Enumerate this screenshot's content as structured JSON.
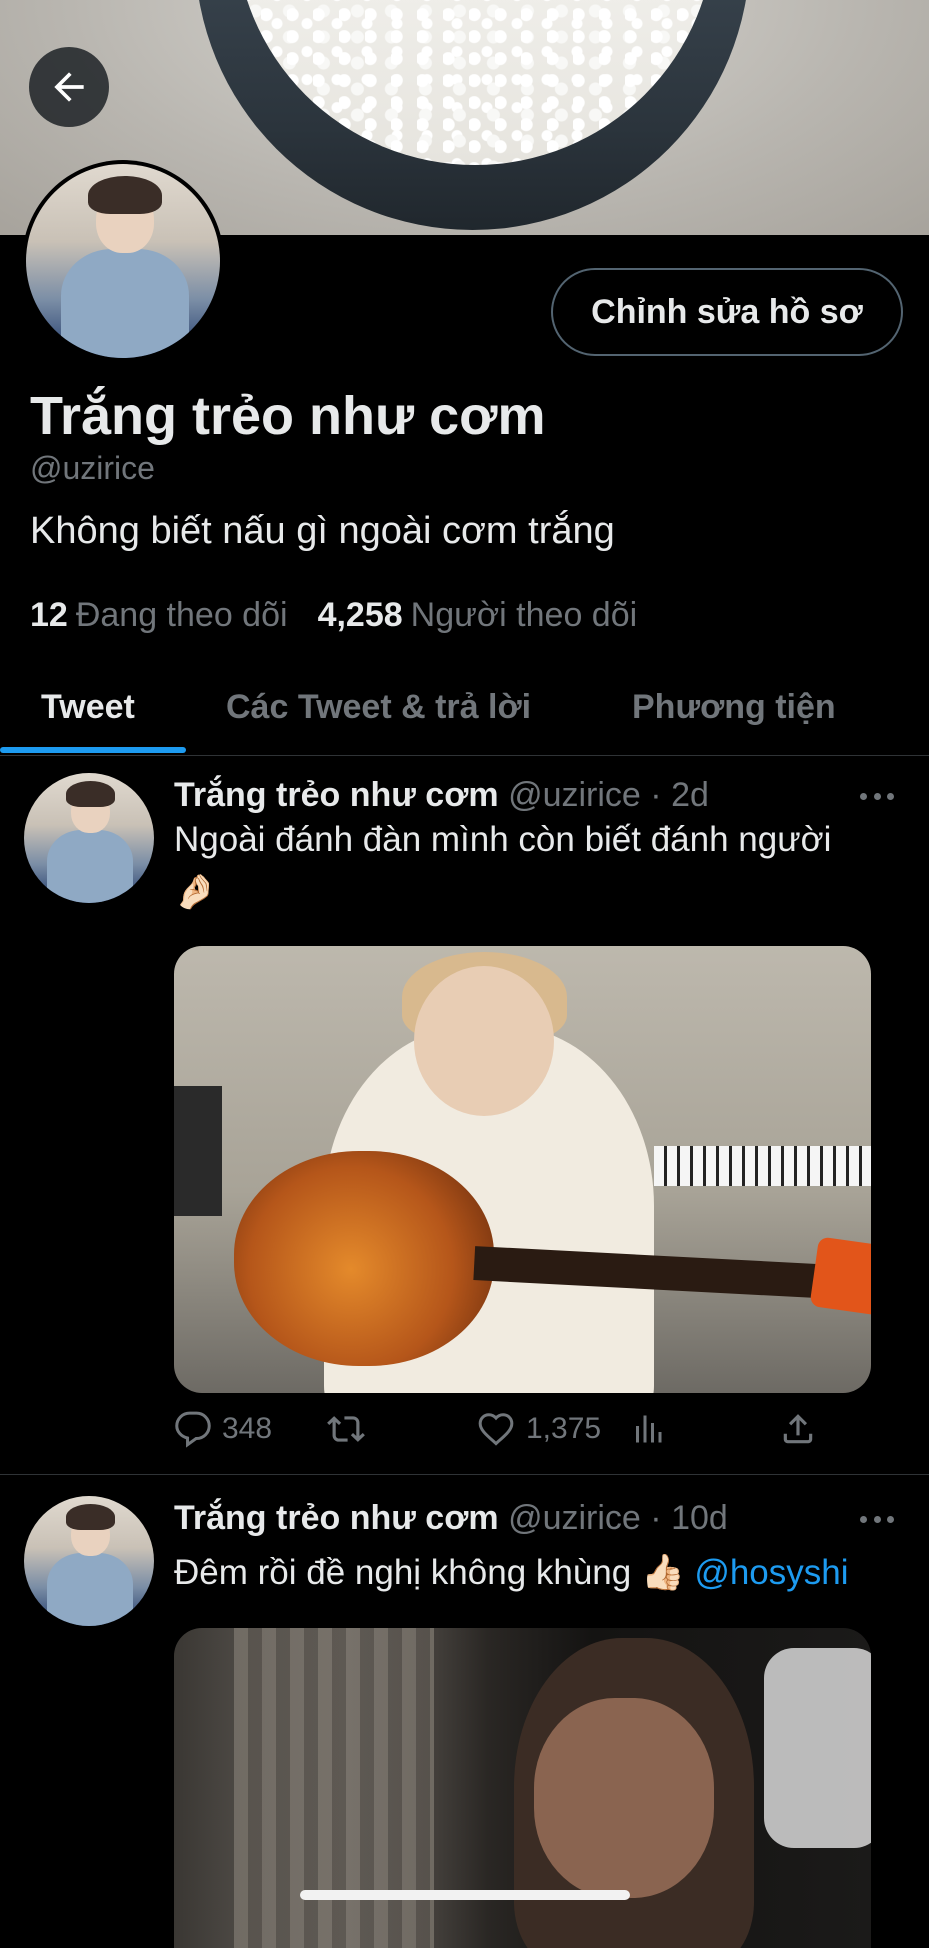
{
  "profile": {
    "edit_button": "Chỉnh sửa hồ sơ",
    "display_name": "Trắng trẻo như cơm",
    "handle": "@uzirice",
    "bio": "Không biết nấu gì ngoài cơm trắng",
    "following_count": "12",
    "following_label": "Đang theo dõi",
    "followers_count": "4,258",
    "followers_label": "Người theo dõi"
  },
  "tabs": [
    {
      "label": "Tweet",
      "active": true
    },
    {
      "label": "Các Tweet & trả lời",
      "active": false
    },
    {
      "label": "Phương tiện",
      "active": false
    }
  ],
  "tweets": [
    {
      "name": "Trắng trẻo như cơm",
      "handle": "@uzirice",
      "time": "2d",
      "text": "Ngoài đánh đàn mình còn biết đánh người",
      "emoji": "🤌🏻",
      "replies": "348",
      "likes": "1,375"
    },
    {
      "name": "Trắng trẻo như cơm",
      "handle": "@uzirice",
      "time": "10d",
      "text": "Đêm rồi đề nghị không khùng",
      "emoji": "👍🏻",
      "mention": "@hosyshi"
    }
  ],
  "colors": {
    "background": "#000000",
    "accent": "#1d9bf0",
    "secondary_text": "#71767b",
    "primary_text": "#e7e9ea"
  },
  "icons": [
    "back-arrow-icon",
    "more-icon",
    "reply-icon",
    "retweet-icon",
    "like-icon",
    "views-icon",
    "share-icon"
  ]
}
